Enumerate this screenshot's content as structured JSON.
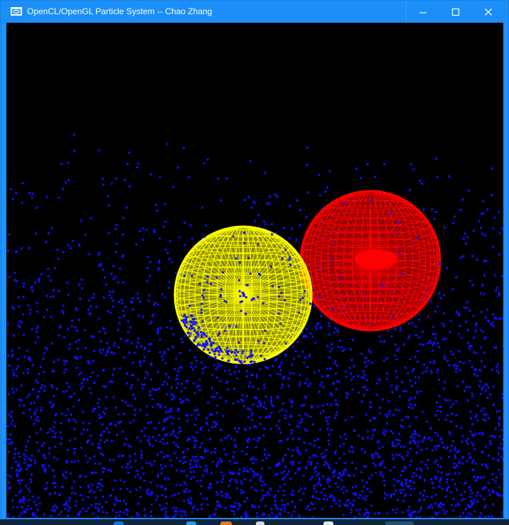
{
  "window": {
    "title": "OpenCL/OpenGL Particle System -- Chao Zhang",
    "icon": "app-window-icon",
    "controls": [
      "minimize-icon",
      "maximize-icon",
      "close-icon"
    ]
  },
  "scene": {
    "background_color": "#000000",
    "particle_color": "#1010ff",
    "sphere_colors": {
      "yellow": "#ffff00",
      "red": "#ff0000"
    },
    "particle_count_estimate": 3000
  },
  "taskbar": {
    "icons": [
      "taskbar-app-1",
      "taskbar-app-2",
      "taskbar-app-3",
      "taskbar-app-4",
      "taskbar-app-5",
      "taskbar-app-6"
    ]
  }
}
